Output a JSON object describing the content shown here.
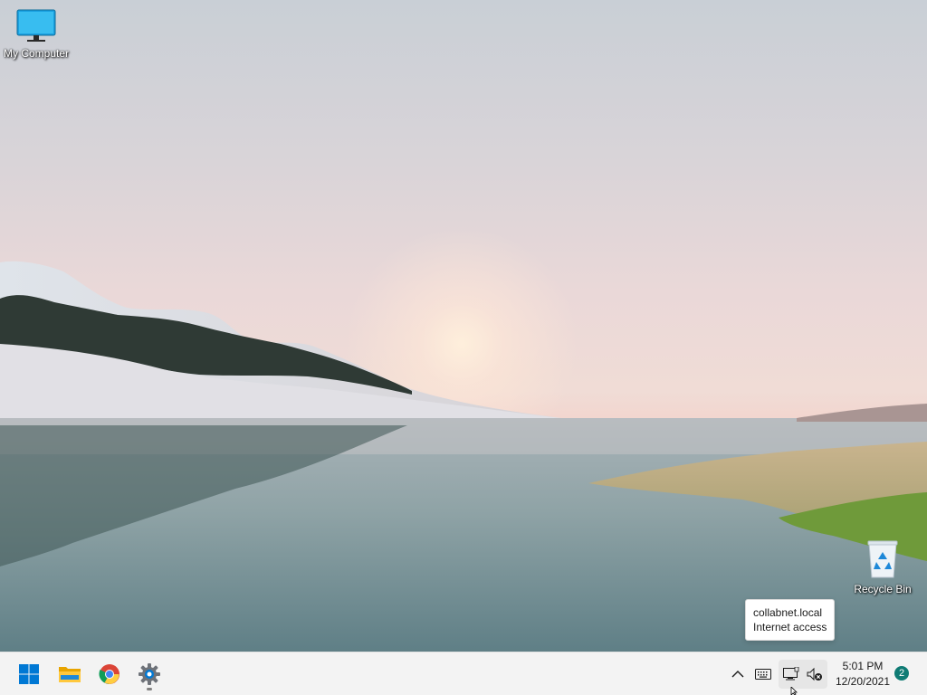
{
  "desktop": {
    "icons": [
      {
        "label": "My Computer",
        "icon": "monitor-icon"
      },
      {
        "label": "Recycle Bin",
        "icon": "recycle-bin-icon"
      }
    ]
  },
  "tooltip": {
    "line1": "collabnet.local",
    "line2": "Internet access"
  },
  "taskbar": {
    "pinned": [
      {
        "name": "Start",
        "icon": "windows-logo-icon"
      },
      {
        "name": "File Explorer",
        "icon": "folder-icon"
      },
      {
        "name": "Google Chrome",
        "icon": "chrome-icon"
      },
      {
        "name": "Settings",
        "icon": "gear-icon"
      }
    ],
    "tray": {
      "icons": [
        "chevron-up-icon",
        "keyboard-icon",
        "network-icon",
        "volume-muted-icon"
      ]
    },
    "clock": {
      "time": "5:01 PM",
      "date": "12/20/2021"
    },
    "notifications": {
      "count": "2"
    }
  },
  "colors": {
    "taskbar_bg": "#f3f3f3",
    "notification_badge": "#0f7b74",
    "windows_blue": "#0078d4"
  }
}
